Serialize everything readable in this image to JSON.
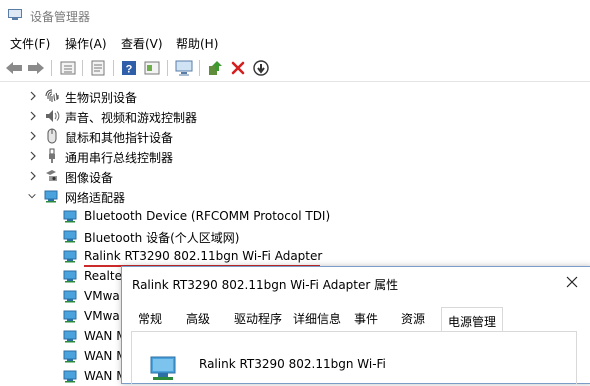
{
  "window": {
    "title": "设备管理器"
  },
  "menu": [
    "文件(F)",
    "操作(A)",
    "查看(V)",
    "帮助(H)"
  ],
  "toolbar": {
    "icons": [
      "back-icon",
      "forward-icon",
      "view-icon",
      "properties-icon",
      "help-icon",
      "show-hidden-icon",
      "monitor-icon",
      "update-driver-icon",
      "uninstall-icon",
      "disable-icon"
    ]
  },
  "tree": {
    "categories": [
      {
        "label": "生物识别设备",
        "icon": "fingerprint-icon",
        "expanded": false
      },
      {
        "label": "声音、视频和游戏控制器",
        "icon": "speaker-icon",
        "expanded": false
      },
      {
        "label": "鼠标和其他指针设备",
        "icon": "mouse-icon",
        "expanded": false
      },
      {
        "label": "通用串行总线控制器",
        "icon": "usb-icon",
        "expanded": false
      },
      {
        "label": "图像设备",
        "icon": "camera-icon",
        "expanded": false
      },
      {
        "label": "网络适配器",
        "icon": "network-adapter-icon",
        "expanded": true
      }
    ],
    "adapters": [
      "Bluetooth Device (RFCOMM Protocol TDI)",
      "Bluetooth 设备(个人区域网)",
      "Ralink RT3290 802.11bgn Wi-Fi Adapter",
      "Realte",
      "VMwa",
      "VMwa",
      "WAN M",
      "WAN M",
      "WAN M"
    ]
  },
  "dialog": {
    "title": "Ralink RT3290 802.11bgn Wi-Fi Adapter 属性",
    "tabs": [
      "常规",
      "高级",
      "驱动程序",
      "详细信息",
      "事件",
      "资源",
      "电源管理"
    ],
    "active_tab": "电源管理",
    "device_name": "Ralink RT3290 802.11bgn Wi-Fi"
  }
}
